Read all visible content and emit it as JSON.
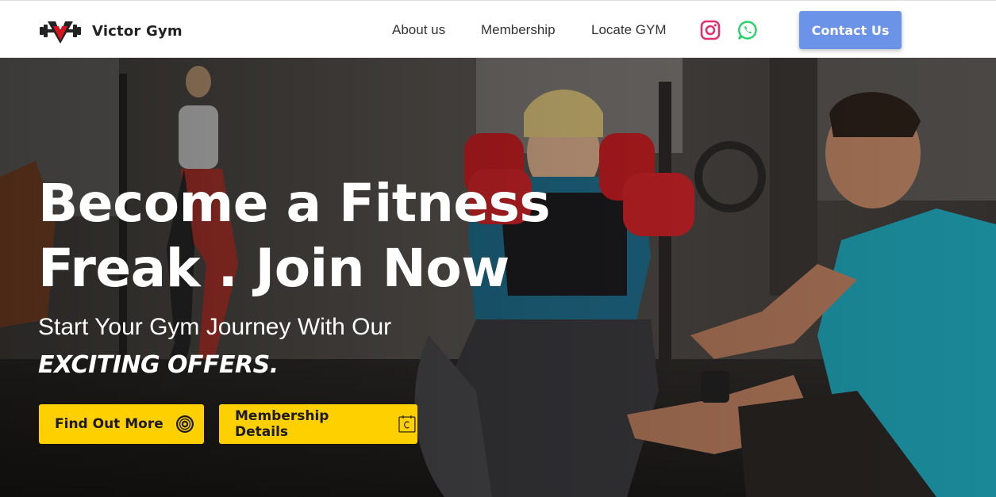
{
  "brand": {
    "name": "Victor Gym",
    "logo_icon": "dumbbell-v-logo-icon"
  },
  "nav": {
    "links": [
      "About us",
      "Membership",
      "Locate GYM"
    ],
    "social": [
      {
        "name": "instagram-icon",
        "color": "#e1306c"
      },
      {
        "name": "whatsapp-icon",
        "color": "#25d366"
      }
    ],
    "contact_label": "Contact Us"
  },
  "hero": {
    "title_line1": "Become a Fitness",
    "title_line2": "Freak . Join Now",
    "subtitle": "Start Your Gym Journey With Our",
    "offer": "EXCITING OFFERS.",
    "buttons": [
      {
        "label": "Find Out More",
        "icon": "target-icon"
      },
      {
        "label": "Membership Details",
        "icon": "calendar-icon"
      }
    ]
  },
  "colors": {
    "accent_yellow": "#ffd000",
    "contact_blue": "#6b93e8",
    "logo_red": "#d9131b"
  }
}
